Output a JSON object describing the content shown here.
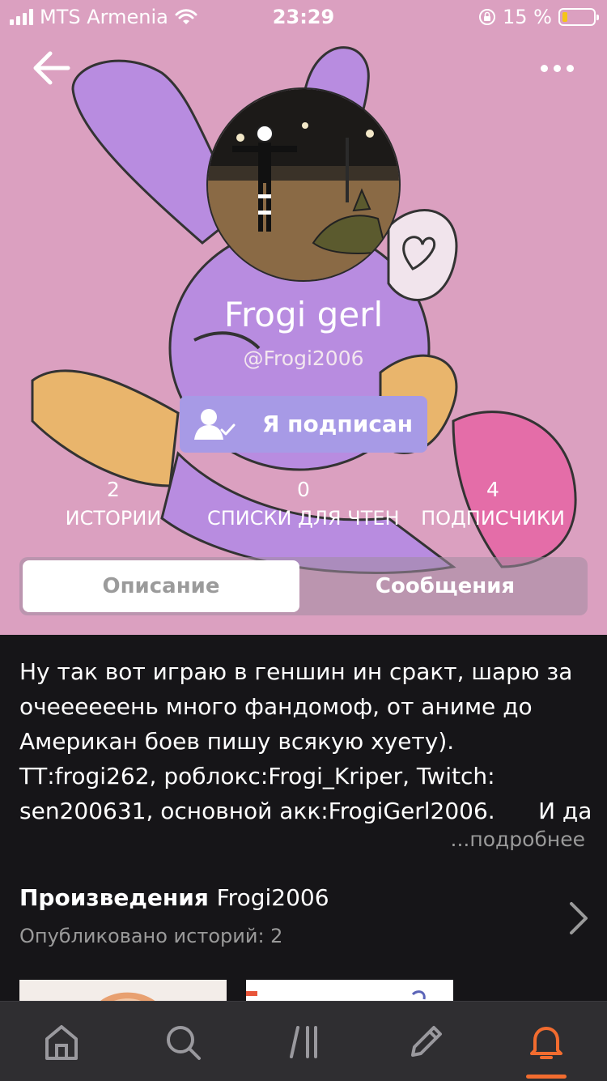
{
  "status_bar": {
    "carrier": "MTS Armenia",
    "time": "23:29",
    "battery": "15 %"
  },
  "profile": {
    "display_name": "Frogi gerl",
    "username": "@Frogi2006",
    "follow_label": "Я подписан"
  },
  "stats": [
    {
      "value": "2",
      "label": "ИСТОРИИ"
    },
    {
      "value": "0",
      "label": "СПИСКИ ДЛЯ ЧТЕНИ"
    },
    {
      "value": "4",
      "label": "ПОДПИСЧИКИ"
    }
  ],
  "tabs": {
    "description": "Описание",
    "messages": "Сообщения"
  },
  "description": {
    "lines": [
      "Ну так вот играю в геншин ин сракт, шарю за",
      "очееееeень много фандомоф, от аниме до",
      "Американ боев пишу всякую хуету).",
      "ТТ:frogi262, роблокс:Frogi_Kriper, Twitch:",
      "sen200631, основной акк:FrogiGerl2006.      И да"
    ],
    "more": "...подробнее"
  },
  "works": {
    "title": "Произведения",
    "user": "Frogi2006",
    "subtitle": "Опубликовано историй: 2"
  },
  "colors": {
    "header_bg": "#dba0c0",
    "follow_button": "#a79ae6",
    "accent": "#f26c2f",
    "page_bg": "#161518",
    "tabbar_bg": "#2f2e31"
  },
  "tabbar": {
    "icons": [
      "home-icon",
      "search-icon",
      "library-icon",
      "write-icon",
      "notifications-icon"
    ],
    "active": "notifications-icon"
  }
}
